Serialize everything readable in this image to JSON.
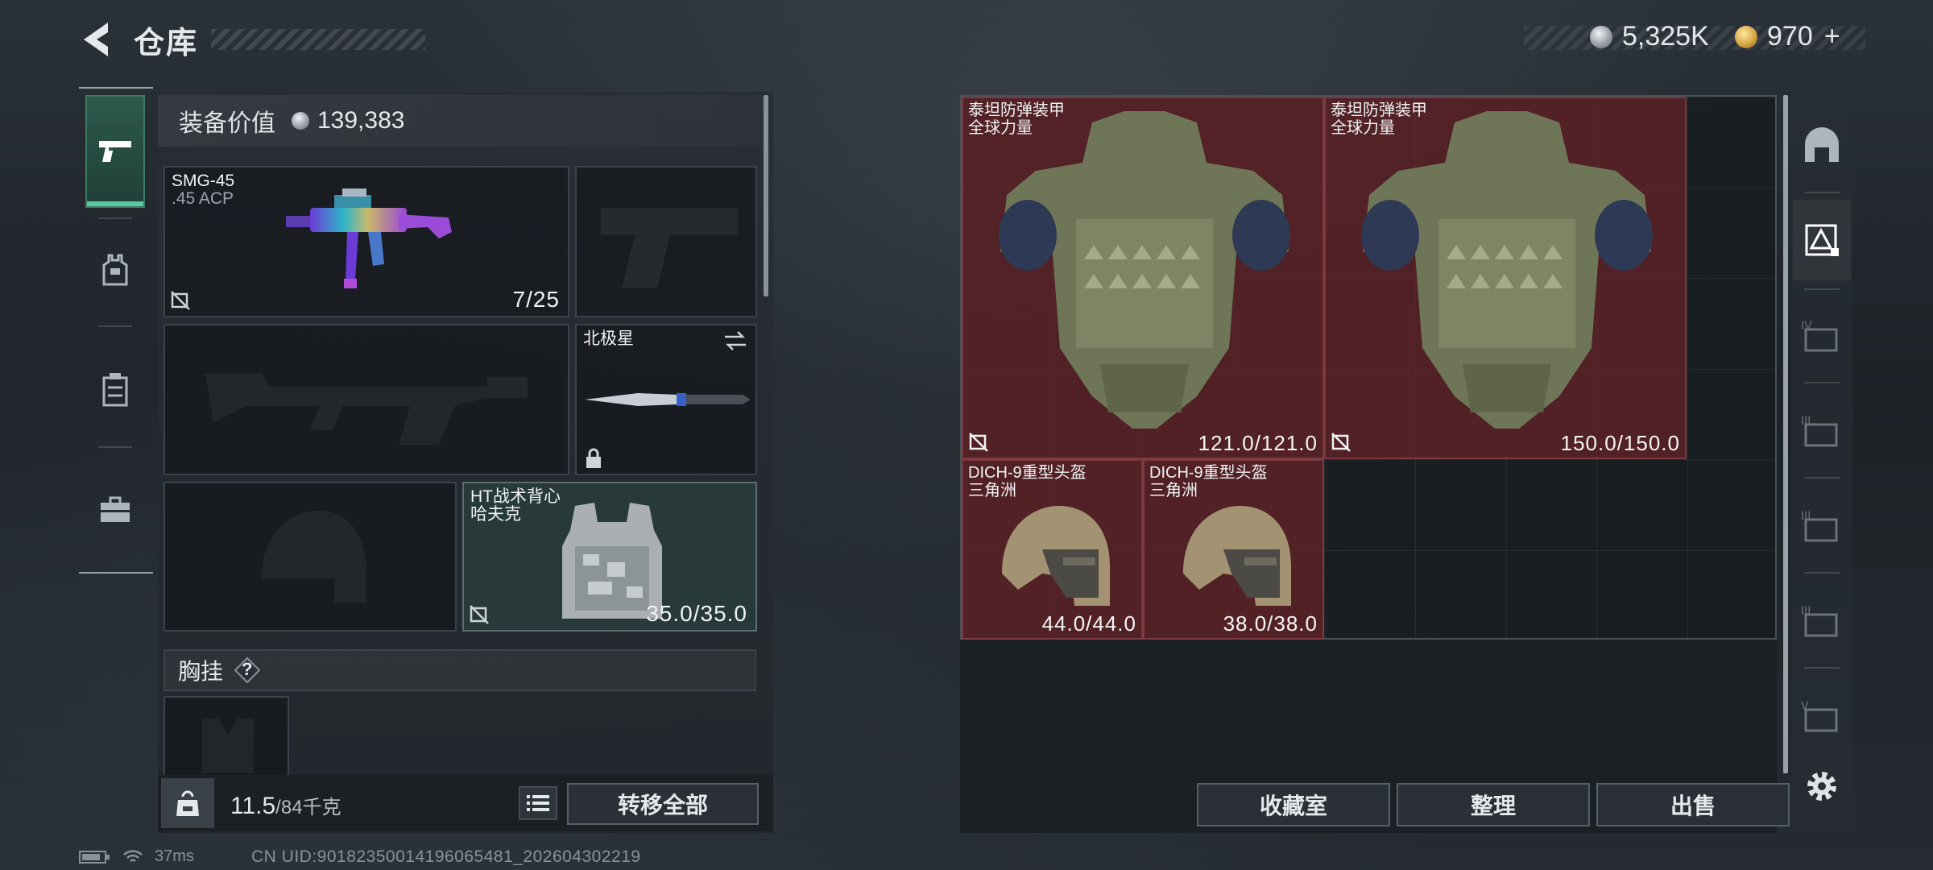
{
  "header": {
    "title": "仓库",
    "currency_silver": "5,325K",
    "currency_gold": "970",
    "gold_plus": "+"
  },
  "loadout": {
    "value_label": "装备价值",
    "value": "139,383",
    "primary": {
      "name": "SMG-45",
      "ammo": ".45 ACP",
      "count": "7/25"
    },
    "melee": {
      "name": "北极星"
    },
    "vest": {
      "name": "HT战术背心",
      "map": "哈夫克",
      "durability": "35.0/35.0"
    },
    "rig_label": "胸挂",
    "rig_help": "?",
    "weight": "11.5",
    "weight_max": "/84千克",
    "transfer_all": "转移全部"
  },
  "stash": {
    "items": [
      {
        "name": "泰坦防弹装甲",
        "sub": "全球力量",
        "durability": "121.0/121.0"
      },
      {
        "name": "泰坦防弹装甲",
        "sub": "全球力量",
        "durability": "150.0/150.0"
      },
      {
        "name": "DICH-9重型头盔",
        "sub": "三角洲",
        "durability": "44.0/44.0"
      },
      {
        "name": "DICH-9重型头盔",
        "sub": "三角洲",
        "durability": "38.0/38.0"
      }
    ],
    "buttons": {
      "collection": "收藏室",
      "sort": "整理",
      "sell": "出售"
    }
  },
  "status": {
    "ping": "37ms",
    "uid": "CN UID:9018235001419606548​1_202604302219"
  },
  "colors": {
    "accent_green": "#5ac8a0",
    "item_red": "#682228"
  }
}
